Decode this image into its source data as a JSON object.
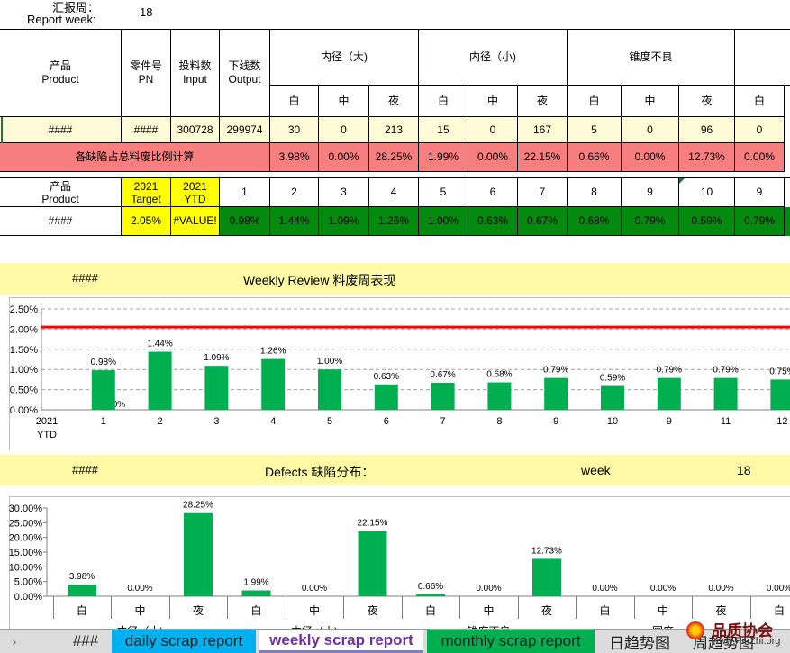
{
  "report_header": {
    "label_cn": "汇报周：",
    "label_en": "Report week:",
    "week": "18"
  },
  "defects_table": {
    "product": {
      "cn": "产品",
      "en": "Product",
      "value": "####"
    },
    "pn": {
      "cn": "零件号",
      "en": "PN",
      "value": "####"
    },
    "input": {
      "cn": "投料数",
      "en": "Input",
      "value": "300728"
    },
    "output": {
      "cn": "下线数",
      "en": "Output",
      "value": "299974"
    },
    "groups": [
      {
        "name": "内径（大)",
        "shifts": [
          "白",
          "中",
          "夜"
        ],
        "counts": [
          "30",
          "0",
          "213"
        ],
        "pcts": [
          "3.98%",
          "0.00%",
          "28.25%"
        ]
      },
      {
        "name": "内径（小)",
        "shifts": [
          "白",
          "中",
          "夜"
        ],
        "counts": [
          "15",
          "0",
          "167"
        ],
        "pcts": [
          "1.99%",
          "0.00%",
          "22.15%"
        ]
      },
      {
        "name": "锥度不良",
        "shifts": [
          "白",
          "中",
          "夜"
        ],
        "counts": [
          "5",
          "0",
          "96"
        ],
        "pcts": [
          "0.66%",
          "0.00%",
          "12.73%"
        ]
      },
      {
        "name": "",
        "shifts": [
          "白"
        ],
        "counts": [
          "0"
        ],
        "pcts": [
          "0.00%"
        ]
      }
    ],
    "ratio_label": "各缺陷占总料废比例计算"
  },
  "weekly_table": {
    "product_cn": "产品",
    "product_en": "Product",
    "target_label": "2021\nTarget",
    "ytd_label": "2021\nYTD",
    "weeks": [
      "1",
      "2",
      "3",
      "4",
      "5",
      "6",
      "7",
      "8",
      "9",
      "10",
      "9"
    ],
    "product_value": "####",
    "target_value": "2.05%",
    "ytd_value": "#VALUE!",
    "week_values": [
      "0.98%",
      "1.44%",
      "1.09%",
      "1.26%",
      "1.00%",
      "0.63%",
      "0.67%",
      "0.68%",
      "0.79%",
      "0.59%",
      "0.79%"
    ]
  },
  "weekly_band": {
    "code": "####",
    "title": "Weekly Review 料废周表现"
  },
  "defects_band": {
    "code": "####",
    "title": "Defects 缺陷分布：",
    "week_label": "week",
    "week": "18"
  },
  "colors": {
    "bar": "#00b050",
    "target_line": "#ff0000",
    "band": "#fffaa5",
    "pink": "#f77f80",
    "dark_green": "#058a10"
  },
  "chart_data": [
    {
      "type": "bar",
      "categories": [
        "2021\nYTD",
        "1",
        "2",
        "3",
        "4",
        "5",
        "6",
        "7",
        "8",
        "9",
        "10",
        "9",
        "11",
        "12"
      ],
      "values": [
        0.0,
        0.98,
        1.44,
        1.09,
        1.26,
        1.0,
        0.63,
        0.67,
        0.68,
        0.79,
        0.59,
        0.79,
        0.79,
        0.75
      ],
      "labels": [
        "0.00%",
        "0.98%",
        "1.44%",
        "1.09%",
        "1.26%",
        "1.00%",
        "0.63%",
        "0.67%",
        "0.68%",
        "0.79%",
        "0.59%",
        "0.79%",
        "0.79%",
        "0.75%"
      ],
      "target": 2.05,
      "yticks": [
        "0.00%",
        "0.50%",
        "1.00%",
        "1.50%",
        "2.00%",
        "2.50%"
      ],
      "ylim": [
        0,
        2.5
      ],
      "grid": true
    },
    {
      "type": "bar",
      "categories": [
        "白",
        "中",
        "夜",
        "白",
        "中",
        "夜",
        "白",
        "中",
        "夜",
        "白",
        "中",
        "夜",
        "白"
      ],
      "groups": [
        "内径（大)",
        "内径（小)",
        "锥度不良",
        "圆度"
      ],
      "values": [
        3.98,
        0.0,
        28.25,
        1.99,
        0.0,
        22.15,
        0.66,
        0.0,
        12.73,
        0.0,
        0.0,
        0.0,
        0.0
      ],
      "labels": [
        "3.98%",
        "0.00%",
        "28.25%",
        "1.99%",
        "0.00%",
        "22.15%",
        "0.66%",
        "0.00%",
        "12.73%",
        "0.00%",
        "0.00%",
        "0.00%",
        "0.00%"
      ],
      "yticks": [
        "0.00%",
        "5.00%",
        "10.00%",
        "15.00%",
        "20.00%",
        "25.00%",
        "30.00%"
      ],
      "ylim": [
        0,
        30
      ],
      "grid": false
    }
  ],
  "sheet_tabs": {
    "nav_arrow": "›",
    "tabs": [
      "###",
      "daily scrap report",
      "weekly scrap report",
      "monthly scrap report",
      "日趋势图",
      "周趋势图"
    ],
    "active": "weekly scrap report"
  },
  "watermark": {
    "text": "品质协会",
    "url": "www.PinZhi.org"
  }
}
